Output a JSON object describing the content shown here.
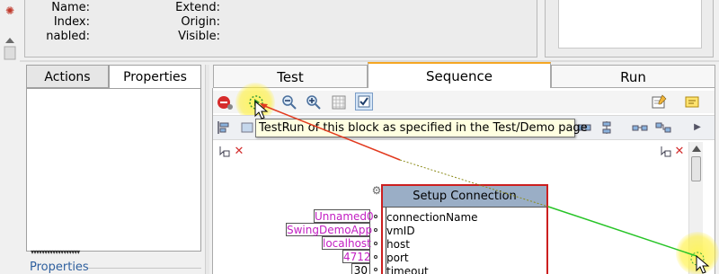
{
  "info": {
    "name_label": "Name:",
    "index_label": "Index:",
    "enabled_label": "nabled:",
    "extend_label": "Extend:",
    "origin_label": "Origin:",
    "visible_label": "Visible:"
  },
  "left_panel": {
    "tabs": [
      {
        "label": "Actions"
      },
      {
        "label": "Properties"
      }
    ],
    "active_tab": "Properties",
    "footer_link": "Properties"
  },
  "right_panel": {
    "tabs": [
      {
        "label": "Test"
      },
      {
        "label": "Sequence"
      },
      {
        "label": "Run"
      }
    ],
    "active_tab": "Sequence"
  },
  "tooltip": "TestRun of this block as specified in the Test/Demo page",
  "block": {
    "title": "Setup Connection",
    "params": [
      {
        "name": "connectionName",
        "value": "Unnamed0"
      },
      {
        "name": "vmID",
        "value": "SwingDemoApp"
      },
      {
        "name": "host",
        "value": "localhost"
      },
      {
        "name": "port",
        "value": "4712"
      },
      {
        "name": "timeout",
        "value": "30"
      }
    ]
  },
  "colors": {
    "tab_accent": "#f5a623",
    "block_border": "#cc1f1f",
    "block_header": "#9aaec6",
    "param_value": "#c21ec2",
    "link": "#2e5f9e",
    "highlight": "#fff550"
  },
  "icons": {
    "toolbar_primary": [
      "stop-icon",
      "run-block-icon",
      "zoom-out-icon",
      "zoom-in-icon",
      "grid-icon",
      "checkbox-icon",
      "notes-icon",
      "comment-icon"
    ],
    "toolbar_secondary": [
      "align-left-icon",
      "align-center-icon",
      "align-top-icon",
      "distribute-icon",
      "connect-icon",
      "branch-icon"
    ]
  }
}
